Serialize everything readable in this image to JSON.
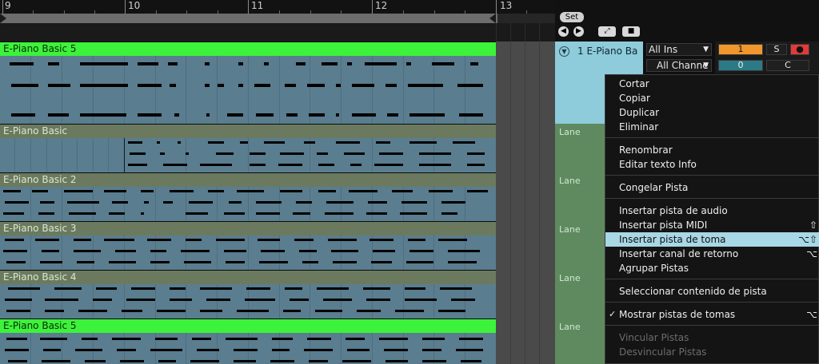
{
  "ruler": {
    "bars": [
      "9",
      "10",
      "11",
      "12",
      "13"
    ]
  },
  "mixer": {
    "set_label": "Set",
    "track_name": "1 E-Piano Ba",
    "input_type": "All Ins",
    "input_channel": "All Channe",
    "track_number": "1",
    "solo_label": "S",
    "volume_value": "0",
    "crossfade_label": "C"
  },
  "tracks": [
    {
      "name": "E-Piano Basic 5"
    },
    {
      "name": "E-Piano Basic",
      "lane": "Lane"
    },
    {
      "name": "E-Piano Basic 2",
      "lane": "Lane"
    },
    {
      "name": "E-Piano Basic 3",
      "lane": "Lane"
    },
    {
      "name": "E-Piano Basic 4",
      "lane": "Lane"
    },
    {
      "name": "E-Piano Basic 5",
      "lane": "Lane"
    }
  ],
  "menu": {
    "items": [
      {
        "label": "Cortar"
      },
      {
        "label": "Copiar"
      },
      {
        "label": "Duplicar"
      },
      {
        "label": "Eliminar"
      },
      {
        "label": "Renombrar"
      },
      {
        "label": "Editar texto Info"
      },
      {
        "label": "Congelar Pista"
      },
      {
        "label": "Insertar pista de audio"
      },
      {
        "label": "Insertar pista MIDI",
        "shortcut": "⇧"
      },
      {
        "label": "Insertar pista de toma",
        "shortcut": "⌥⇧",
        "highlighted": true
      },
      {
        "label": "Insertar canal de retorno",
        "shortcut": "⌥"
      },
      {
        "label": "Agrupar Pistas"
      },
      {
        "label": "Seleccionar contenido de pista"
      },
      {
        "label": "Mostrar pistas de tomas",
        "shortcut": "⌥",
        "checked": true
      },
      {
        "label": "Vincular Pistas",
        "disabled": true
      },
      {
        "label": "Desvincular Pistas",
        "disabled": true
      }
    ]
  },
  "colors": {
    "active_clip": "#3df23a",
    "take_lane_header": "#6b7a5f",
    "clip_body": "#5a7d8f",
    "track_header": "#8ecbdb",
    "lane_header": "#5f8a60",
    "menu_highlight": "#a8d7e6",
    "track_number_bg": "#f0962c",
    "volume_bg": "#2b7a85",
    "record_arm": "#e13a3a"
  },
  "icons": [
    "back-icon",
    "forward-icon",
    "expand-icon",
    "lock-icon",
    "fold-icon",
    "record-arm-icon",
    "checkmark-icon"
  ]
}
